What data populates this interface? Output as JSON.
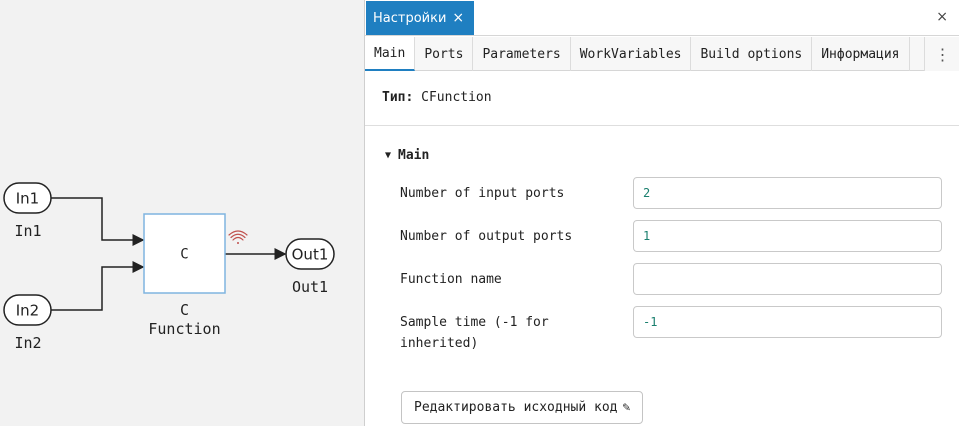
{
  "diagram": {
    "inputs": [
      {
        "port_label": "In1",
        "caption": "In1"
      },
      {
        "port_label": "In2",
        "caption": "In2"
      }
    ],
    "outputs": [
      {
        "port_label": "Out1",
        "caption": "Out1"
      }
    ],
    "block": {
      "symbol": "C",
      "caption_line1": "C",
      "caption_line2": "Function",
      "signal_icon": "wifi-signal-icon"
    }
  },
  "panel": {
    "title": "Настройки",
    "tab_close_glyph": "×",
    "close_glyph": "×",
    "tabs": [
      {
        "label": "Main",
        "active": true
      },
      {
        "label": "Ports",
        "active": false
      },
      {
        "label": "Parameters",
        "active": false
      },
      {
        "label": "WorkVariables",
        "active": false
      },
      {
        "label": "Build options",
        "active": false
      },
      {
        "label": "Информация",
        "active": false
      }
    ],
    "more_glyph": "⋮",
    "type_label": "Тип:",
    "type_value": "CFunction",
    "section": {
      "caret": "▼",
      "title": "Main"
    },
    "properties": [
      {
        "label": "Number of input ports",
        "value": "2"
      },
      {
        "label": "Number of output ports",
        "value": "1"
      },
      {
        "label": "Function name",
        "value": ""
      },
      {
        "label": "Sample time (-1 for inherited)",
        "value": "-1"
      }
    ],
    "edit_button": {
      "label": "Редактировать исходный код",
      "icon": "pencil-icon"
    }
  },
  "colors": {
    "accent": "#1f7fc1",
    "value_text": "#1a7f6e",
    "block_border": "#7fb4e0"
  }
}
